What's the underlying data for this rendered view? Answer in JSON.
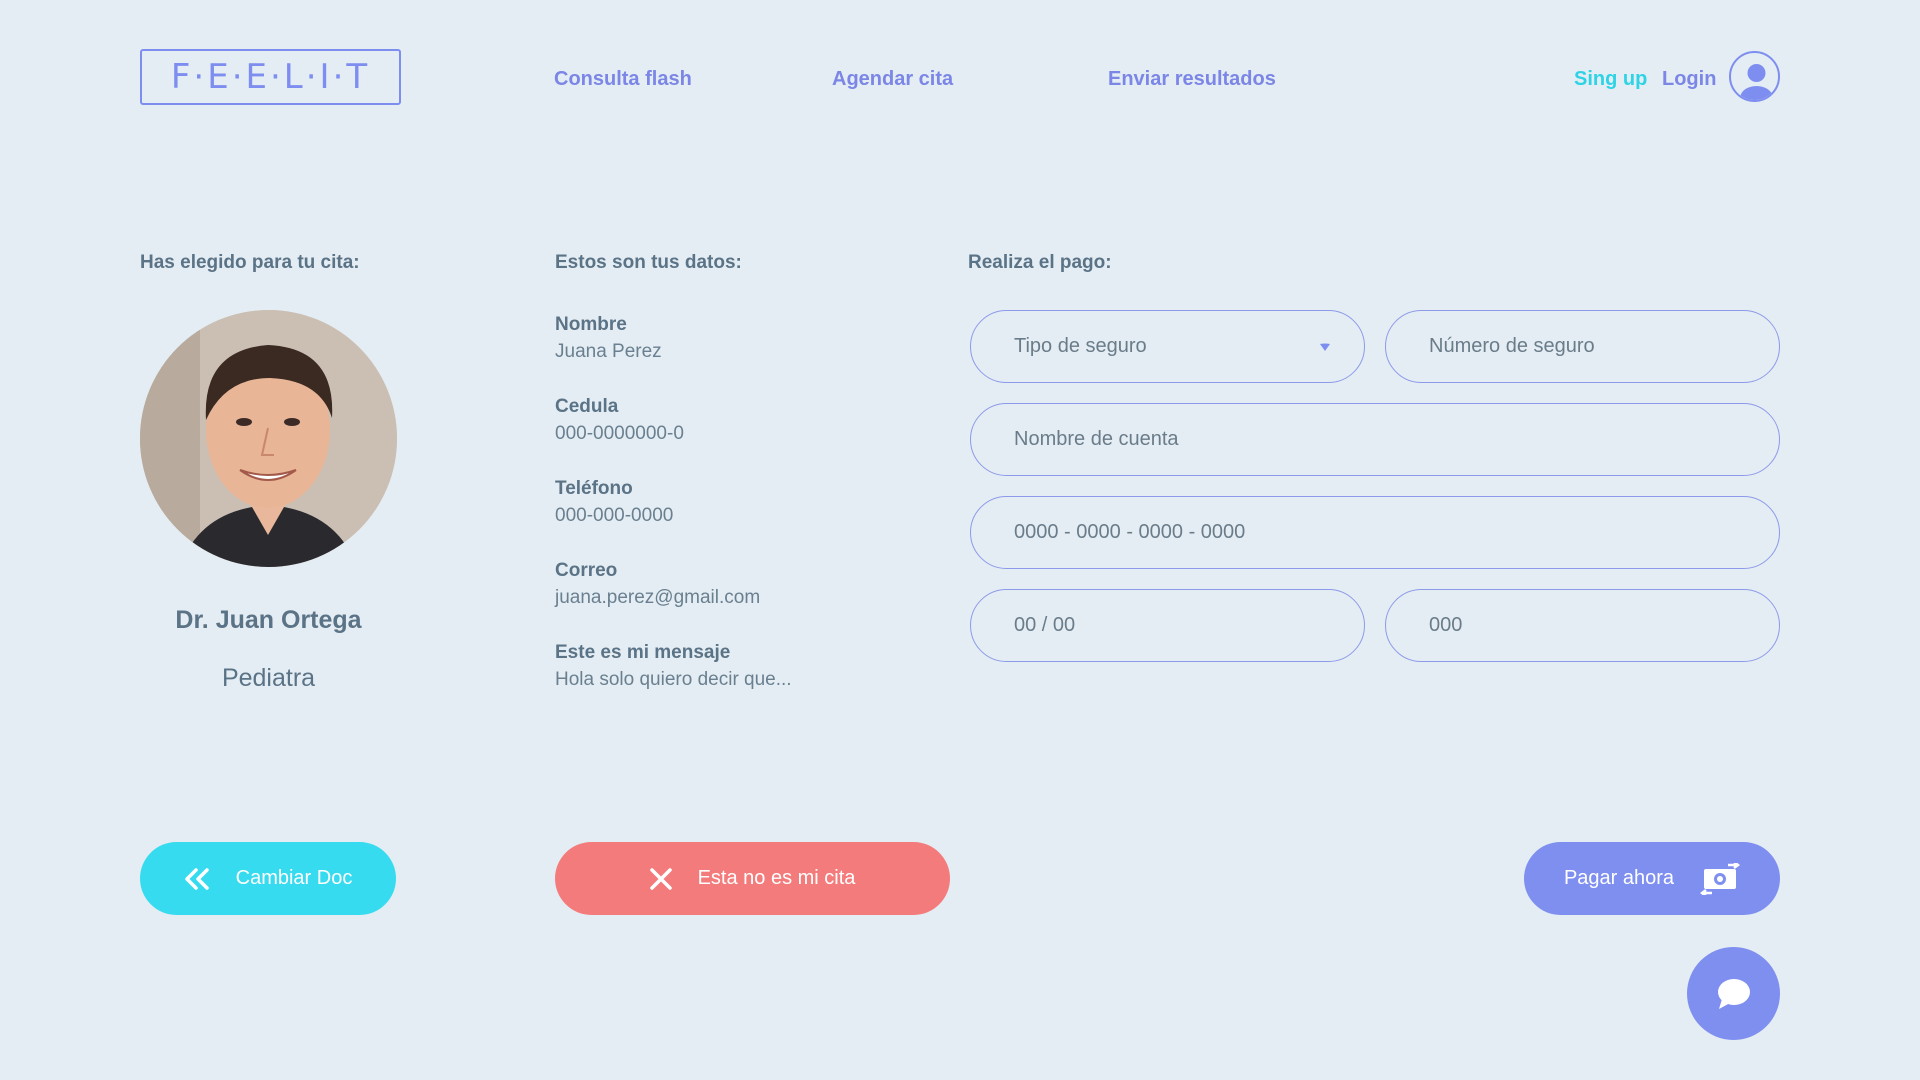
{
  "header": {
    "logo": "F·E·E·L·I·T",
    "nav": [
      "Consulta flash",
      "Agendar cita",
      "Enviar resultados"
    ],
    "signup": "Sing up",
    "login": "Login"
  },
  "doctor": {
    "title": "Has elegido para tu cita:",
    "name": "Dr. Juan Ortega",
    "specialty": "Pediatra"
  },
  "user_data": {
    "title": "Estos son tus datos:",
    "fields": [
      {
        "label": "Nombre",
        "value": "Juana Perez"
      },
      {
        "label": "Cedula",
        "value": "000-0000000-0"
      },
      {
        "label": "Teléfono",
        "value": "000-000-0000"
      },
      {
        "label": "Correo",
        "value": "juana.perez@gmail.com"
      },
      {
        "label": "Este es mi mensaje",
        "value": "Hola solo quiero decir que..."
      }
    ]
  },
  "payment": {
    "title": "Realiza el pago:",
    "insurance_type": "Tipo de seguro",
    "insurance_number": "Número de seguro",
    "account_name": "Nombre de cuenta",
    "card_number": "0000 - 0000 - 0000 - 0000",
    "expiry": "00 / 00",
    "cvv": "000"
  },
  "buttons": {
    "change_doc": "Cambiar Doc",
    "not_my_appointment": "Esta no es mi cita",
    "pay_now": "Pagar ahora"
  },
  "icons": {
    "change_doc": "double-chevron-left-icon",
    "cancel": "close-icon",
    "pay": "money-exchange-icon",
    "chat": "chat-bubble-icon",
    "avatar": "user-icon",
    "dropdown": "chevron-down-icon"
  },
  "colors": {
    "background": "#e4edf3",
    "accent": "#7f8ff0",
    "cyan": "#37dbef",
    "danger": "#f47b7b",
    "text": "#5b7386"
  }
}
